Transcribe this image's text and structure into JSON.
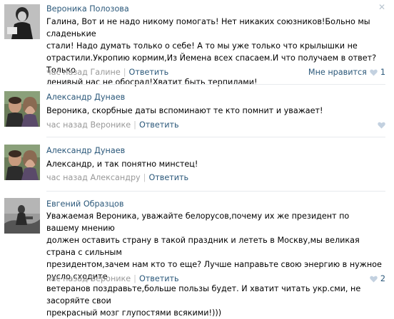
{
  "comments": [
    {
      "author": "Вероника Полозова",
      "text_lines": [
        "Галина, Вот и не надо никому помогать! Нет никаких союзников!Больно мы сладенькие",
        "стали! Надо думать только о себе! А то мы уже только что крылышки не",
        "отрастили.Укропию кормим,Из Йемена всех спасаем.И что получаем в ответ?Только",
        "ленивый нас не обосрал!Хватит быть терпилами!"
      ],
      "time": "час назад Галине",
      "reply": "Ответить",
      "like_label": "Мне нравится",
      "like_count": "1"
    },
    {
      "author": "Александр Дунаев",
      "text_lines": [
        "Вероника, скорбные даты вспоминают те кто помнит и уважает!"
      ],
      "time": "час назад Веронике",
      "reply": "Ответить"
    },
    {
      "author": "Александр Дунаев",
      "text_lines": [
        "Александр, и так понятно минстец!"
      ],
      "time": "час назад Александру",
      "reply": "Ответить"
    },
    {
      "author": "Евгений Образцов",
      "text_lines": [
        "Уважаемая Вероника, уважайте белорусов,почему их же президент по вашему мнению",
        "должен оставить страну в такой праздник и лететь в Москву,мы великая страна с сильным",
        "президентом,зачем нам кто то еще? Лучше направьте свою энергию в нужное русло,сходите",
        "ветеранов поздравьте,больше пользы будет. И хватит читать укр.сми, не засоряйте свои",
        "прекрасный мозг глупостями всякими!)))"
      ],
      "time": "час назад Веронике",
      "reply": "Ответить",
      "like_count": "2"
    }
  ],
  "icons": {
    "close": "close-icon",
    "heart": "heart-icon"
  },
  "colors": {
    "link": "#2b587a",
    "meta": "#999999",
    "heart": "#c3d1e0"
  }
}
